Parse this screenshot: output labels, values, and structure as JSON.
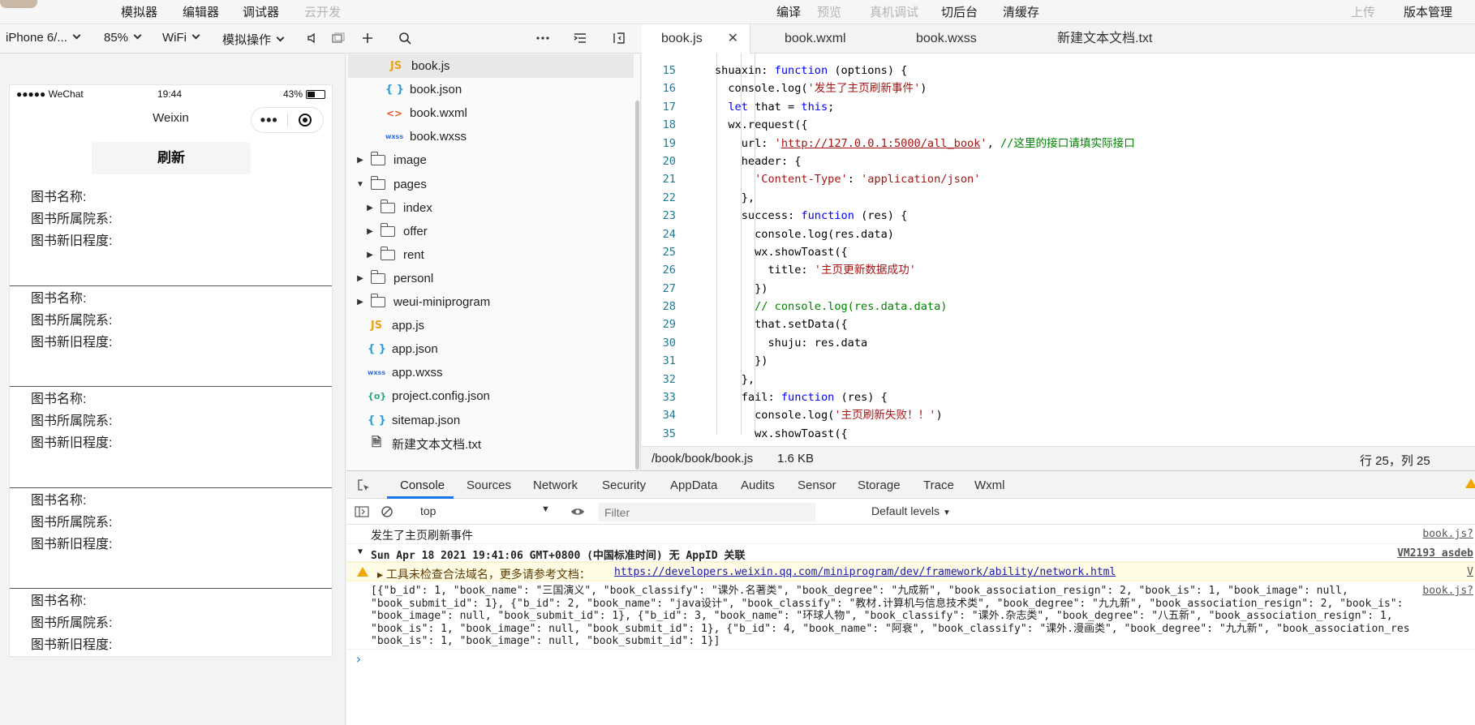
{
  "topbar": {
    "menu": [
      "模拟器",
      "编辑器",
      "调试器",
      "云开发"
    ],
    "actions": [
      "编译",
      "预览",
      "真机调试",
      "切后台",
      "清缓存"
    ],
    "right": [
      "上传",
      "版本管理"
    ]
  },
  "toolbar": {
    "device": "iPhone 6/...",
    "zoom": "85%",
    "network": "WiFi",
    "sim_op": "模拟操作"
  },
  "phone": {
    "carrier": "●●●●● WeChat",
    "time": "19:44",
    "battery": "43%",
    "nav_title": "Weixin",
    "refresh_label": "刷新",
    "labels": {
      "name": "图书名称:",
      "dept": "图书所属院系:",
      "degree": "图书新旧程度:"
    },
    "item_count": 5
  },
  "explorer": {
    "items": [
      {
        "name": "book.js",
        "kind": "js"
      },
      {
        "name": "book.json",
        "kind": "json"
      },
      {
        "name": "book.wxml",
        "kind": "wxml"
      },
      {
        "name": "book.wxss",
        "kind": "wxss"
      },
      {
        "name": "image",
        "kind": "folder"
      },
      {
        "name": "pages",
        "kind": "folder-open"
      },
      {
        "name": "index",
        "kind": "folder"
      },
      {
        "name": "offer",
        "kind": "folder"
      },
      {
        "name": "rent",
        "kind": "folder"
      },
      {
        "name": "personl",
        "kind": "folder"
      },
      {
        "name": "weui-miniprogram",
        "kind": "folder"
      },
      {
        "name": "app.js",
        "kind": "js"
      },
      {
        "name": "app.json",
        "kind": "json"
      },
      {
        "name": "app.wxss",
        "kind": "wxss"
      },
      {
        "name": "project.config.json",
        "kind": "cfg"
      },
      {
        "name": "sitemap.json",
        "kind": "json"
      },
      {
        "name": "新建文本文档.txt",
        "kind": "txt"
      }
    ]
  },
  "editor": {
    "tabs": [
      "book.js",
      "book.wxml",
      "book.wxss",
      "新建文本文档.txt"
    ],
    "path": "/book/book/book.js",
    "size": "1.6 KB",
    "cursor": "行 25，列 25",
    "line_numbers": [
      "15",
      "16",
      "17",
      "18",
      "19",
      "20",
      "21",
      "22",
      "23",
      "24",
      "25",
      "26",
      "27",
      "28",
      "29",
      "30",
      "31",
      "32",
      "33",
      "34",
      "35"
    ]
  },
  "devtools": {
    "tabs": [
      "Console",
      "Sources",
      "Network",
      "Security",
      "AppData",
      "Audits",
      "Sensor",
      "Storage",
      "Trace",
      "Wxml"
    ],
    "context": "top",
    "filter_placeholder": "Filter",
    "levels": "Default levels",
    "log1": "发生了主页刷新事件",
    "log1_src": "book.js?",
    "group": "Sun Apr 18 2021 19:41:06 GMT+0800 (中国标准时间) 无 AppID 关联",
    "group_src": "VM2193 asdeb",
    "warn_text": "▸ 工具未检查合法域名，更多请参考文档：",
    "warn_link": "https://developers.weixin.qq.com/miniprogram/dev/framework/ability/network.html",
    "warn_src": "V",
    "data_lines": [
      "[{\"b_id\": 1, \"book_name\": \"三国演义\", \"book_classify\": \"课外.名著类\", \"book_degree\": \"九成新\", \"book_association_resign\": 2, \"book_is\": 1, \"book_image\": null,",
      "\"book_submit_id\": 1}, {\"b_id\": 2, \"book_name\": \"java设计\", \"book_classify\": \"教材.计算机与信息技术类\", \"book_degree\": \"九九新\", \"book_association_resign\": 2, \"book_is\":",
      "\"book_image\": null, \"book_submit_id\": 1}, {\"b_id\": 3, \"book_name\": \"环球人物\", \"book_classify\": \"课外.杂志类\", \"book_degree\": \"八五新\", \"book_association_resign\": 1,",
      "\"book_is\": 1, \"book_image\": null, \"book_submit_id\": 1}, {\"b_id\": 4, \"book_name\": \"阿衰\", \"book_classify\": \"课外.漫画类\", \"book_degree\": \"九九新\", \"book_association_res",
      "\"book_is\": 1, \"book_image\": null, \"book_submit_id\": 1}]"
    ],
    "data_src": "book.js?",
    "prompt": "›"
  }
}
